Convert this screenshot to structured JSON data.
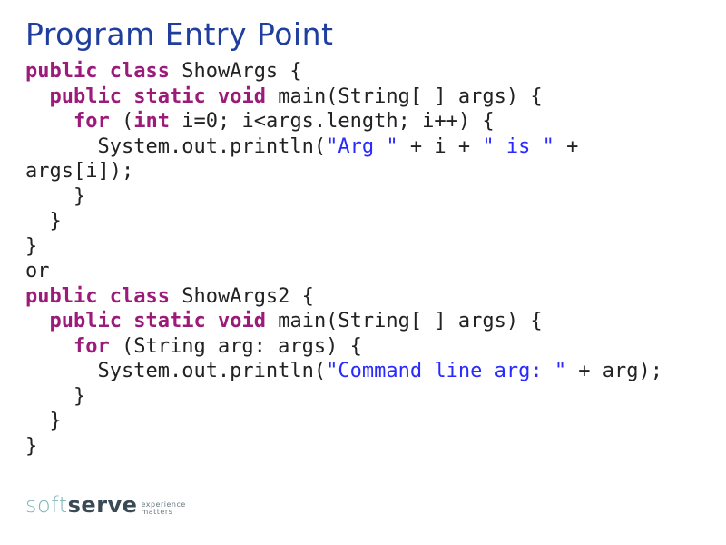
{
  "title": "Program Entry Point",
  "code": {
    "c1_l1": {
      "kw1": "public",
      "sp1": " ",
      "kw2": "class",
      "sp2": " ",
      "name": "ShowArgs {"
    },
    "c1_l2": {
      "ind": "  ",
      "kw1": "public",
      "sp1": " ",
      "kw2": "static",
      "sp2": " ",
      "kw3": "void",
      "sp3": " ",
      "rest": "main(String[ ] args) {"
    },
    "c1_l3": {
      "ind": "    ",
      "kw1": "for",
      "sp1": " (",
      "kw2": "int",
      "sp2": " ",
      "rest": "i=0; i<args.length; i++) {"
    },
    "c1_l4a": {
      "ind": "      ",
      "pre": "System.out.println(",
      "str1": "\"Arg \"",
      "mid1": " + i + ",
      "str2": "\" is \"",
      "mid2": " +"
    },
    "c1_l4b": {
      "rest": "args[i]);"
    },
    "c1_l5": {
      "text": "    }"
    },
    "c1_l6": {
      "text": "  }"
    },
    "c1_l7": {
      "text": "}"
    },
    "or": {
      "text": "or "
    },
    "c2_l1": {
      "kw1": "public",
      "sp1": " ",
      "kw2": "class",
      "sp2": " ",
      "name": "ShowArgs2 {"
    },
    "c2_l2": {
      "ind": "  ",
      "kw1": "public",
      "sp1": " ",
      "kw2": "static",
      "sp2": " ",
      "kw3": "void",
      "sp3": " ",
      "rest": "main(String[ ] args) {"
    },
    "c2_l3": {
      "ind": "    ",
      "kw1": "for",
      "sp1": " ",
      "rest": "(String arg: args) {"
    },
    "c2_l4": {
      "ind": "      ",
      "pre": "System.out.println(",
      "str": "\"Command line arg: \"",
      "post": " + arg);"
    },
    "c2_l5": {
      "text": "    }"
    },
    "c2_l6": {
      "text": "  }"
    },
    "c2_l7": {
      "text": "}"
    }
  },
  "logo": {
    "soft": "soft",
    "serve": "serve",
    "tag1": "experience",
    "tag2": "matters"
  }
}
